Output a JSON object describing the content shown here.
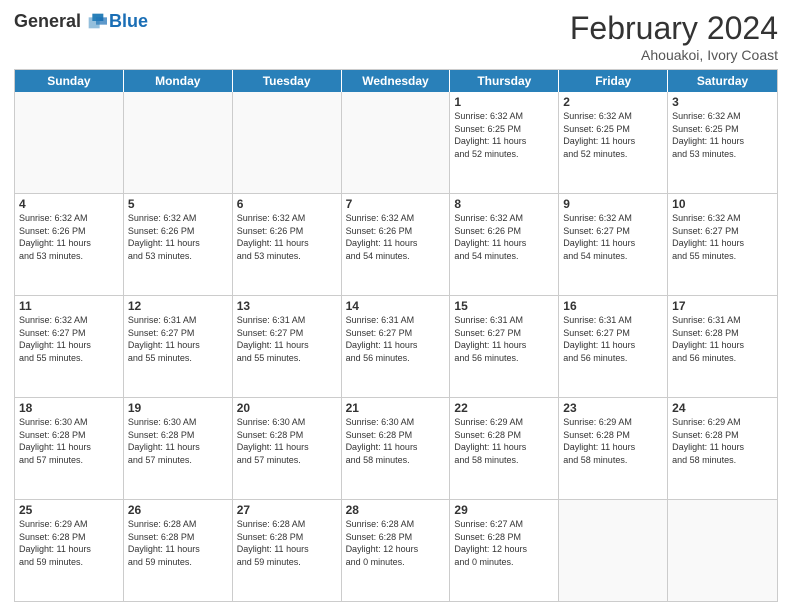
{
  "logo": {
    "general": "General",
    "blue": "Blue"
  },
  "title": "February 2024",
  "location": "Ahouakoi, Ivory Coast",
  "days_of_week": [
    "Sunday",
    "Monday",
    "Tuesday",
    "Wednesday",
    "Thursday",
    "Friday",
    "Saturday"
  ],
  "weeks": [
    [
      {
        "day": "",
        "info": ""
      },
      {
        "day": "",
        "info": ""
      },
      {
        "day": "",
        "info": ""
      },
      {
        "day": "",
        "info": ""
      },
      {
        "day": "1",
        "info": "Sunrise: 6:32 AM\nSunset: 6:25 PM\nDaylight: 11 hours\nand 52 minutes."
      },
      {
        "day": "2",
        "info": "Sunrise: 6:32 AM\nSunset: 6:25 PM\nDaylight: 11 hours\nand 52 minutes."
      },
      {
        "day": "3",
        "info": "Sunrise: 6:32 AM\nSunset: 6:25 PM\nDaylight: 11 hours\nand 53 minutes."
      }
    ],
    [
      {
        "day": "4",
        "info": "Sunrise: 6:32 AM\nSunset: 6:26 PM\nDaylight: 11 hours\nand 53 minutes."
      },
      {
        "day": "5",
        "info": "Sunrise: 6:32 AM\nSunset: 6:26 PM\nDaylight: 11 hours\nand 53 minutes."
      },
      {
        "day": "6",
        "info": "Sunrise: 6:32 AM\nSunset: 6:26 PM\nDaylight: 11 hours\nand 53 minutes."
      },
      {
        "day": "7",
        "info": "Sunrise: 6:32 AM\nSunset: 6:26 PM\nDaylight: 11 hours\nand 54 minutes."
      },
      {
        "day": "8",
        "info": "Sunrise: 6:32 AM\nSunset: 6:26 PM\nDaylight: 11 hours\nand 54 minutes."
      },
      {
        "day": "9",
        "info": "Sunrise: 6:32 AM\nSunset: 6:27 PM\nDaylight: 11 hours\nand 54 minutes."
      },
      {
        "day": "10",
        "info": "Sunrise: 6:32 AM\nSunset: 6:27 PM\nDaylight: 11 hours\nand 55 minutes."
      }
    ],
    [
      {
        "day": "11",
        "info": "Sunrise: 6:32 AM\nSunset: 6:27 PM\nDaylight: 11 hours\nand 55 minutes."
      },
      {
        "day": "12",
        "info": "Sunrise: 6:31 AM\nSunset: 6:27 PM\nDaylight: 11 hours\nand 55 minutes."
      },
      {
        "day": "13",
        "info": "Sunrise: 6:31 AM\nSunset: 6:27 PM\nDaylight: 11 hours\nand 55 minutes."
      },
      {
        "day": "14",
        "info": "Sunrise: 6:31 AM\nSunset: 6:27 PM\nDaylight: 11 hours\nand 56 minutes."
      },
      {
        "day": "15",
        "info": "Sunrise: 6:31 AM\nSunset: 6:27 PM\nDaylight: 11 hours\nand 56 minutes."
      },
      {
        "day": "16",
        "info": "Sunrise: 6:31 AM\nSunset: 6:27 PM\nDaylight: 11 hours\nand 56 minutes."
      },
      {
        "day": "17",
        "info": "Sunrise: 6:31 AM\nSunset: 6:28 PM\nDaylight: 11 hours\nand 56 minutes."
      }
    ],
    [
      {
        "day": "18",
        "info": "Sunrise: 6:30 AM\nSunset: 6:28 PM\nDaylight: 11 hours\nand 57 minutes."
      },
      {
        "day": "19",
        "info": "Sunrise: 6:30 AM\nSunset: 6:28 PM\nDaylight: 11 hours\nand 57 minutes."
      },
      {
        "day": "20",
        "info": "Sunrise: 6:30 AM\nSunset: 6:28 PM\nDaylight: 11 hours\nand 57 minutes."
      },
      {
        "day": "21",
        "info": "Sunrise: 6:30 AM\nSunset: 6:28 PM\nDaylight: 11 hours\nand 58 minutes."
      },
      {
        "day": "22",
        "info": "Sunrise: 6:29 AM\nSunset: 6:28 PM\nDaylight: 11 hours\nand 58 minutes."
      },
      {
        "day": "23",
        "info": "Sunrise: 6:29 AM\nSunset: 6:28 PM\nDaylight: 11 hours\nand 58 minutes."
      },
      {
        "day": "24",
        "info": "Sunrise: 6:29 AM\nSunset: 6:28 PM\nDaylight: 11 hours\nand 58 minutes."
      }
    ],
    [
      {
        "day": "25",
        "info": "Sunrise: 6:29 AM\nSunset: 6:28 PM\nDaylight: 11 hours\nand 59 minutes."
      },
      {
        "day": "26",
        "info": "Sunrise: 6:28 AM\nSunset: 6:28 PM\nDaylight: 11 hours\nand 59 minutes."
      },
      {
        "day": "27",
        "info": "Sunrise: 6:28 AM\nSunset: 6:28 PM\nDaylight: 11 hours\nand 59 minutes."
      },
      {
        "day": "28",
        "info": "Sunrise: 6:28 AM\nSunset: 6:28 PM\nDaylight: 12 hours\nand 0 minutes."
      },
      {
        "day": "29",
        "info": "Sunrise: 6:27 AM\nSunset: 6:28 PM\nDaylight: 12 hours\nand 0 minutes."
      },
      {
        "day": "",
        "info": ""
      },
      {
        "day": "",
        "info": ""
      }
    ]
  ]
}
